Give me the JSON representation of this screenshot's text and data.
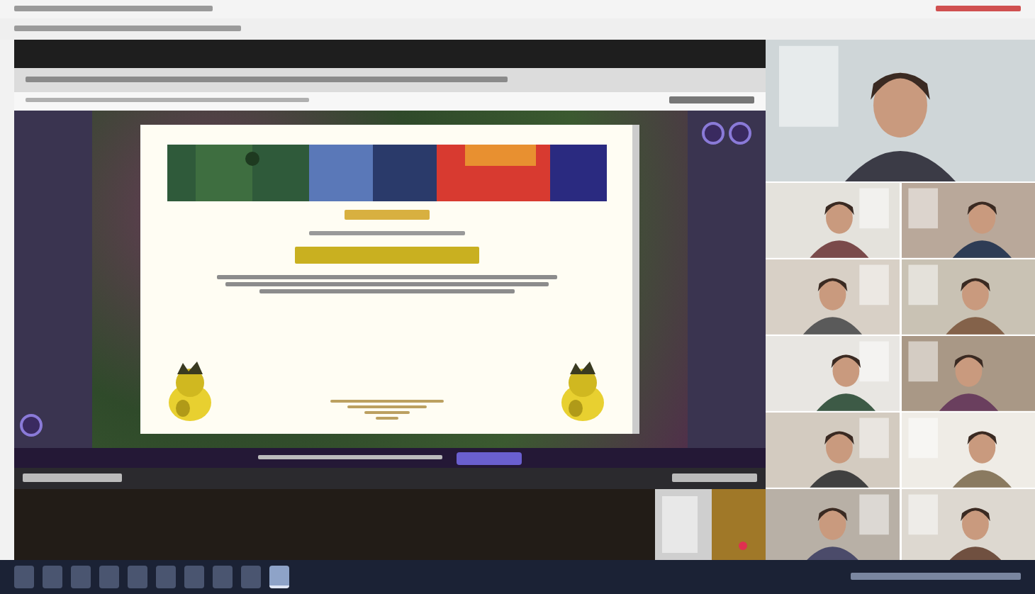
{
  "taskbar": {
    "icons": [
      {
        "selected": false
      },
      {
        "selected": false
      },
      {
        "selected": false
      },
      {
        "selected": false
      },
      {
        "selected": false
      },
      {
        "selected": false
      },
      {
        "selected": false
      },
      {
        "selected": false
      },
      {
        "selected": false
      },
      {
        "selected": true
      }
    ]
  }
}
